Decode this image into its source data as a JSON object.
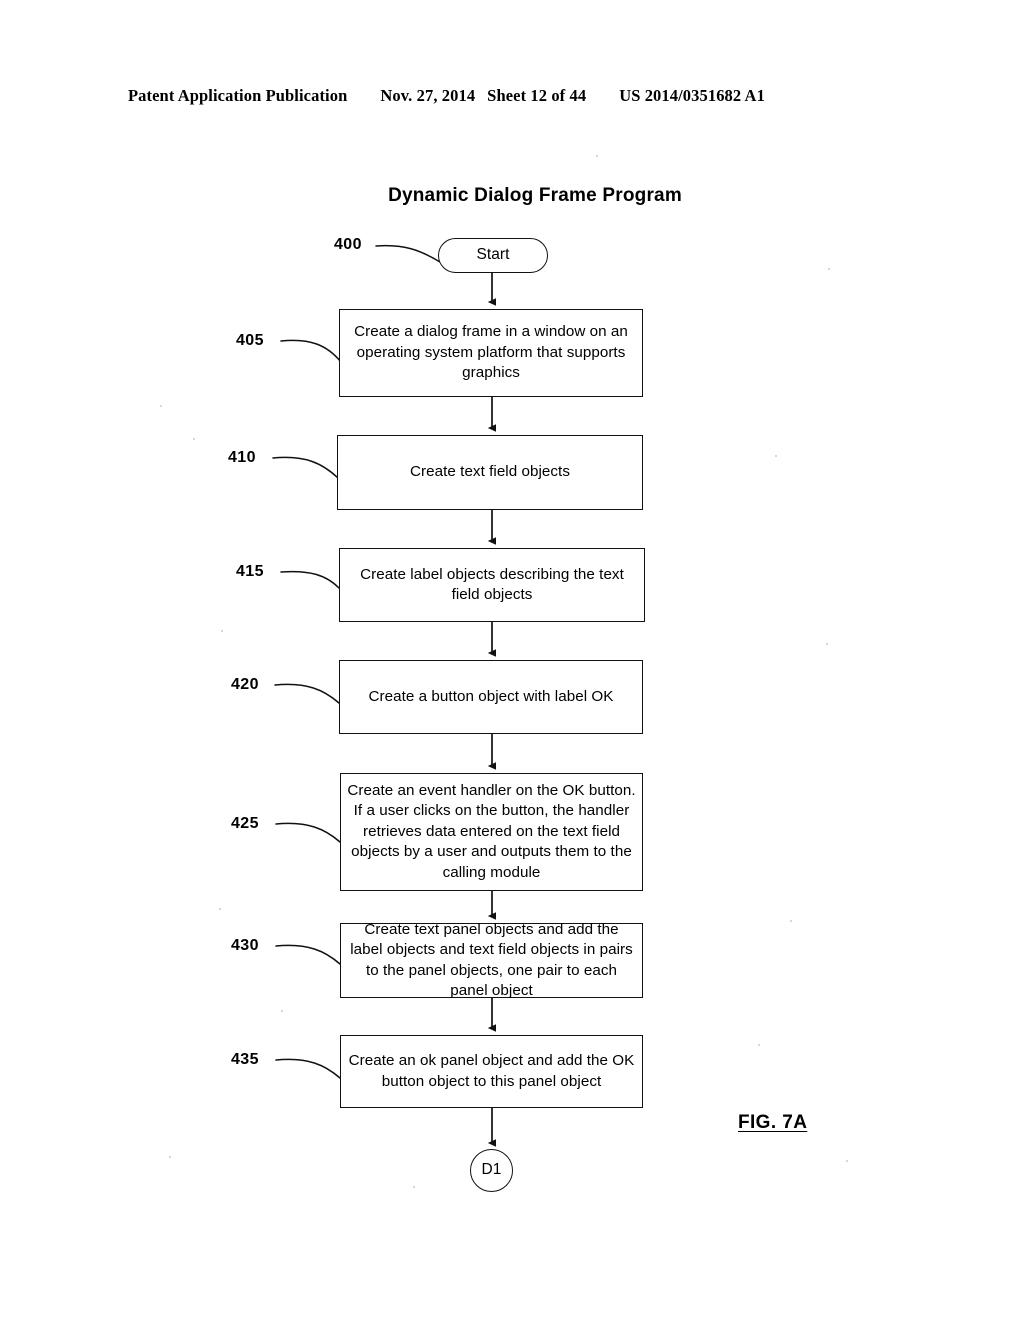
{
  "header": {
    "publication": "Patent Application Publication",
    "date": "Nov. 27, 2014",
    "sheet": "Sheet 12 of 44",
    "pub_number": "US 2014/0351682 A1"
  },
  "figure": {
    "title": "Dynamic Dialog Frame Program",
    "caption": "FIG. 7A"
  },
  "flowchart": {
    "type": "flowchart",
    "orientation": "top-to-bottom",
    "nodes": [
      {
        "ref": "400",
        "shape": "rounded-terminator",
        "label": "Start"
      },
      {
        "ref": "405",
        "shape": "rectangle",
        "label": "Create a dialog frame in a window on an operating system platform that supports graphics"
      },
      {
        "ref": "410",
        "shape": "rectangle",
        "label": "Create text field objects"
      },
      {
        "ref": "415",
        "shape": "rectangle",
        "label": "Create label objects describing the text field objects"
      },
      {
        "ref": "420",
        "shape": "rectangle",
        "label": "Create a button object with label OK"
      },
      {
        "ref": "425",
        "shape": "rectangle",
        "label": "Create an event handler on the OK button.  If a user clicks on the button, the handler retrieves data entered on the text field objects by a user and outputs them to the calling module"
      },
      {
        "ref": "430",
        "shape": "rectangle",
        "label": "Create text panel objects and add the label objects and text field objects in pairs to the panel objects, one pair to each panel object"
      },
      {
        "ref": "435",
        "shape": "rectangle",
        "label": "Create an ok panel object  and add the OK button object to this panel object"
      },
      {
        "ref": "",
        "shape": "circle-connector",
        "label": "D1"
      }
    ],
    "ref_labels": [
      "400",
      "405",
      "410",
      "415",
      "420",
      "425",
      "430",
      "435"
    ],
    "colors": {
      "stroke": "#111111",
      "fill": "#ffffff",
      "text": "#000000",
      "page_background": "#ffffff"
    }
  }
}
